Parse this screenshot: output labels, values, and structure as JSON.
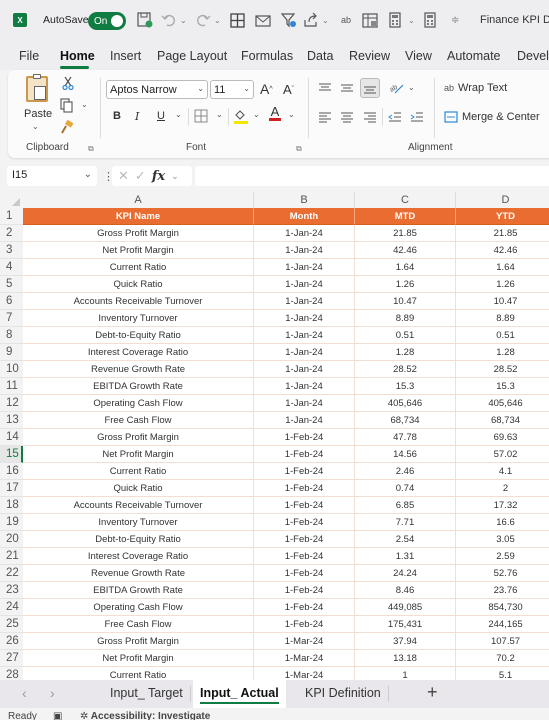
{
  "titlebar": {
    "app_icon": "excel-logo-icon",
    "app_icon_letter": "X",
    "autosave_label": "AutoSave",
    "autosave_state": "On",
    "document_title": "Finance KPI Da",
    "quick_access": [
      "save-icon",
      "undo-icon",
      "redo-icon",
      "borders-icon",
      "email-icon",
      "filter-icon",
      "share-icon",
      "spelling-icon",
      "table-icon",
      "calculator-icon",
      "calculator2-icon",
      "customize-icon"
    ]
  },
  "menubar": {
    "items": [
      "File",
      "Home",
      "Insert",
      "Page Layout",
      "Formulas",
      "Data",
      "Review",
      "View",
      "Automate",
      "Devel"
    ],
    "active": "Home"
  },
  "ribbon": {
    "clipboard": {
      "paste_label": "Paste",
      "group_label": "Clipboard"
    },
    "font": {
      "font_name": "Aptos Narrow",
      "font_size": "11",
      "grow_label": "A",
      "shrink_label": "A",
      "bold_label": "B",
      "italic_label": "I",
      "underline_label": "U",
      "font_color_label": "A",
      "group_label": "Font",
      "highlight_color": "#f5e600",
      "font_color": "#d12020"
    },
    "alignment": {
      "wrap_text_label": "Wrap Text",
      "merge_center_label": "Merge & Center",
      "group_label": "Alignment"
    }
  },
  "formula_bar": {
    "name_box": "I15",
    "fx_label": "fx",
    "formula": ""
  },
  "sheet": {
    "columns": [
      "A",
      "B",
      "C",
      "D"
    ],
    "header": [
      "KPI Name",
      "Month",
      "MTD",
      "YTD"
    ],
    "header_color": "#e96d30",
    "selected_row": 15,
    "rows": [
      {
        "num": "2",
        "cells": [
          "Gross Profit Margin",
          "1-Jan-24",
          "21.85",
          "21.85"
        ]
      },
      {
        "num": "3",
        "cells": [
          "Net Profit Margin",
          "1-Jan-24",
          "42.46",
          "42.46"
        ]
      },
      {
        "num": "4",
        "cells": [
          "Current Ratio",
          "1-Jan-24",
          "1.64",
          "1.64"
        ]
      },
      {
        "num": "5",
        "cells": [
          "Quick Ratio",
          "1-Jan-24",
          "1.26",
          "1.26"
        ]
      },
      {
        "num": "6",
        "cells": [
          "Accounts Receivable Turnover",
          "1-Jan-24",
          "10.47",
          "10.47"
        ]
      },
      {
        "num": "7",
        "cells": [
          "Inventory Turnover",
          "1-Jan-24",
          "8.89",
          "8.89"
        ]
      },
      {
        "num": "8",
        "cells": [
          "Debt-to-Equity Ratio",
          "1-Jan-24",
          "0.51",
          "0.51"
        ]
      },
      {
        "num": "9",
        "cells": [
          "Interest Coverage Ratio",
          "1-Jan-24",
          "1.28",
          "1.28"
        ]
      },
      {
        "num": "10",
        "cells": [
          "Revenue Growth Rate",
          "1-Jan-24",
          "28.52",
          "28.52"
        ]
      },
      {
        "num": "11",
        "cells": [
          "EBITDA Growth Rate",
          "1-Jan-24",
          "15.3",
          "15.3"
        ]
      },
      {
        "num": "12",
        "cells": [
          "Operating Cash Flow",
          "1-Jan-24",
          "405,646",
          "405,646"
        ]
      },
      {
        "num": "13",
        "cells": [
          "Free Cash Flow",
          "1-Jan-24",
          "68,734",
          "68,734"
        ]
      },
      {
        "num": "14",
        "cells": [
          "Gross Profit Margin",
          "1-Feb-24",
          "47.78",
          "69.63"
        ]
      },
      {
        "num": "15",
        "cells": [
          "Net Profit Margin",
          "1-Feb-24",
          "14.56",
          "57.02"
        ]
      },
      {
        "num": "16",
        "cells": [
          "Current Ratio",
          "1-Feb-24",
          "2.46",
          "4.1"
        ]
      },
      {
        "num": "17",
        "cells": [
          "Quick Ratio",
          "1-Feb-24",
          "0.74",
          "2"
        ]
      },
      {
        "num": "18",
        "cells": [
          "Accounts Receivable Turnover",
          "1-Feb-24",
          "6.85",
          "17.32"
        ]
      },
      {
        "num": "19",
        "cells": [
          "Inventory Turnover",
          "1-Feb-24",
          "7.71",
          "16.6"
        ]
      },
      {
        "num": "20",
        "cells": [
          "Debt-to-Equity Ratio",
          "1-Feb-24",
          "2.54",
          "3.05"
        ]
      },
      {
        "num": "21",
        "cells": [
          "Interest Coverage Ratio",
          "1-Feb-24",
          "1.31",
          "2.59"
        ]
      },
      {
        "num": "22",
        "cells": [
          "Revenue Growth Rate",
          "1-Feb-24",
          "24.24",
          "52.76"
        ]
      },
      {
        "num": "23",
        "cells": [
          "EBITDA Growth Rate",
          "1-Feb-24",
          "8.46",
          "23.76"
        ]
      },
      {
        "num": "24",
        "cells": [
          "Operating Cash Flow",
          "1-Feb-24",
          "449,085",
          "854,730"
        ]
      },
      {
        "num": "25",
        "cells": [
          "Free Cash Flow",
          "1-Feb-24",
          "175,431",
          "244,165"
        ]
      },
      {
        "num": "26",
        "cells": [
          "Gross Profit Margin",
          "1-Mar-24",
          "37.94",
          "107.57"
        ]
      },
      {
        "num": "27",
        "cells": [
          "Net Profit Margin",
          "1-Mar-24",
          "13.18",
          "70.2"
        ]
      },
      {
        "num": "28",
        "cells": [
          "Current Ratio",
          "1-Mar-24",
          "1",
          "5.1"
        ]
      }
    ]
  },
  "tabs": {
    "items": [
      "Input_ Target",
      "Input_ Actual",
      "KPI Definition"
    ],
    "active": "Input_ Actual",
    "add_label": "+"
  },
  "statusbar": {
    "ready": "Ready",
    "accessibility": "Accessibility: Investigate"
  }
}
